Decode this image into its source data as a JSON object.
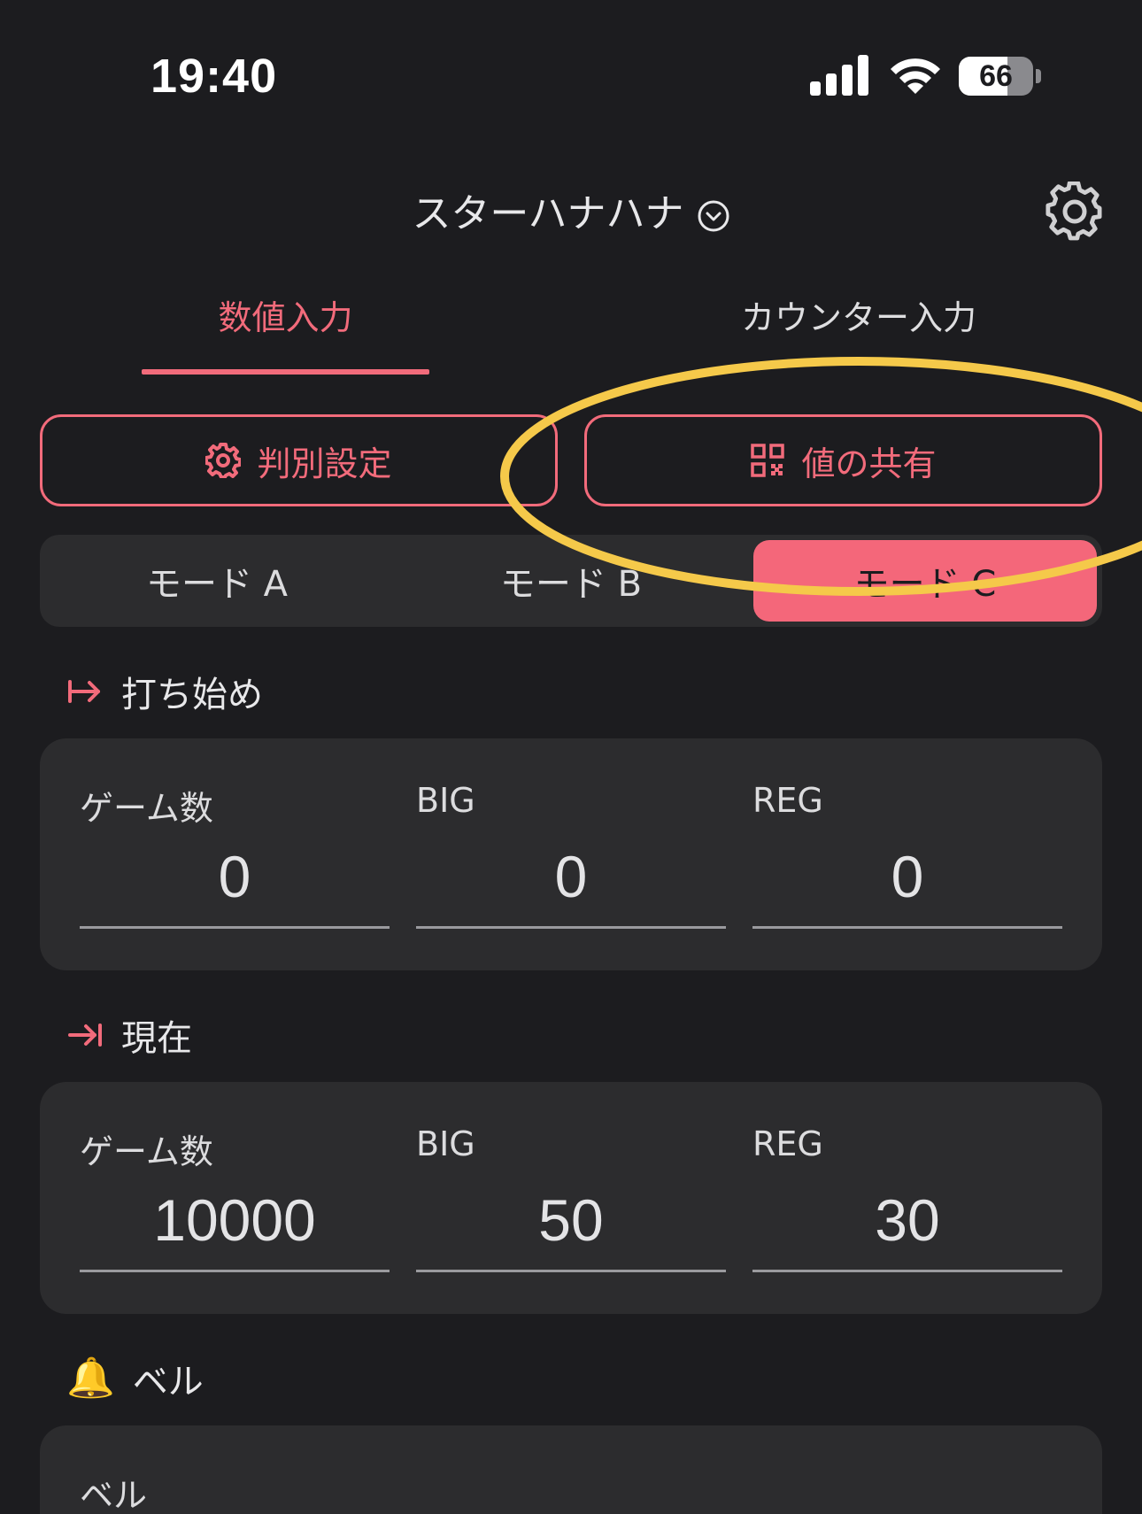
{
  "status_bar": {
    "time": "19:40",
    "battery_percent": 66,
    "battery_text": "66"
  },
  "header": {
    "title": "スターハナハナ",
    "title_icon": "chevron-down-circle-icon",
    "settings_icon": "gear-icon"
  },
  "tabs": [
    {
      "label": "数値入力",
      "active": true
    },
    {
      "label": "カウンター入力",
      "active": false
    }
  ],
  "actions": {
    "judge_label": "判別設定",
    "judge_icon": "gear-icon",
    "share_label": "値の共有",
    "share_icon": "qr-code-icon"
  },
  "modes": [
    {
      "label": "モード A",
      "selected": false
    },
    {
      "label": "モード B",
      "selected": false
    },
    {
      "label": "モード C",
      "selected": true
    }
  ],
  "sections": {
    "start": {
      "title": "打ち始め",
      "icon": "arrow-right-from-line-icon",
      "fields": [
        {
          "label": "ゲーム数",
          "value": "0"
        },
        {
          "label": "BIG",
          "value": "0"
        },
        {
          "label": "REG",
          "value": "0"
        }
      ]
    },
    "current": {
      "title": "現在",
      "icon": "arrow-right-to-line-icon",
      "fields": [
        {
          "label": "ゲーム数",
          "value": "10000"
        },
        {
          "label": "BIG",
          "value": "50"
        },
        {
          "label": "REG",
          "value": "30"
        }
      ]
    },
    "bell": {
      "title": "ベル",
      "icon": "bell-icon",
      "icon_glyph": "🔔",
      "field_label": "ベル"
    }
  },
  "colors": {
    "accent": "#f26b7b",
    "background": "#1c1c1f",
    "card": "#2c2c2e",
    "highlight": "#f5c94a"
  }
}
